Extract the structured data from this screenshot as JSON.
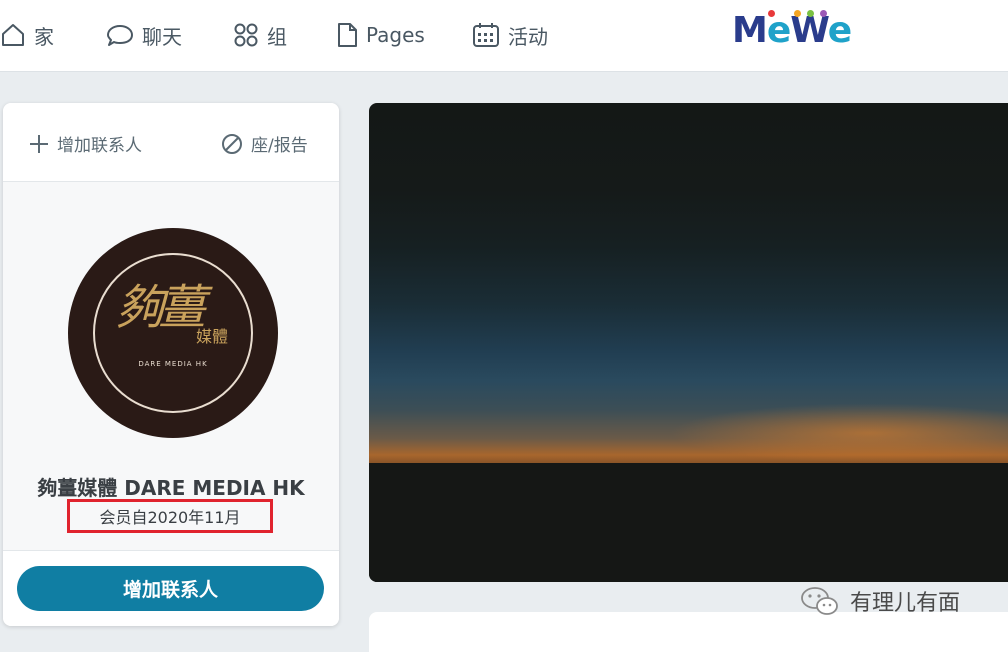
{
  "nav": {
    "items": [
      {
        "label": "家",
        "icon": "home-icon"
      },
      {
        "label": "聊天",
        "icon": "chat-bubble-icon"
      },
      {
        "label": "组",
        "icon": "groups-icon"
      },
      {
        "label": "Pages",
        "icon": "page-icon"
      },
      {
        "label": "活动",
        "icon": "calendar-icon"
      }
    ]
  },
  "logo": {
    "text_m": "M",
    "text_e1": "e",
    "text_w": "W",
    "text_e2": "e",
    "dot_colors": [
      "#e8393a",
      "#f5a623",
      "#7ac142",
      "#9b59b6",
      "#1fa2c9"
    ]
  },
  "profile": {
    "actions": {
      "add_contact": "增加联系人",
      "block_report": "座/报告"
    },
    "avatar": {
      "logo_main": "夠薑",
      "logo_sub": "媒體",
      "logo_en": "DARE MEDIA HK"
    },
    "name": "夠薑媒體 DARE MEDIA HK",
    "member_since": "会员自2020年11月",
    "button_label": "增加联系人",
    "accent_color": "#107ea3",
    "highlight_color": "#e0232e"
  },
  "watermark": {
    "text": "有理儿有面",
    "icon": "wechat-icon"
  }
}
